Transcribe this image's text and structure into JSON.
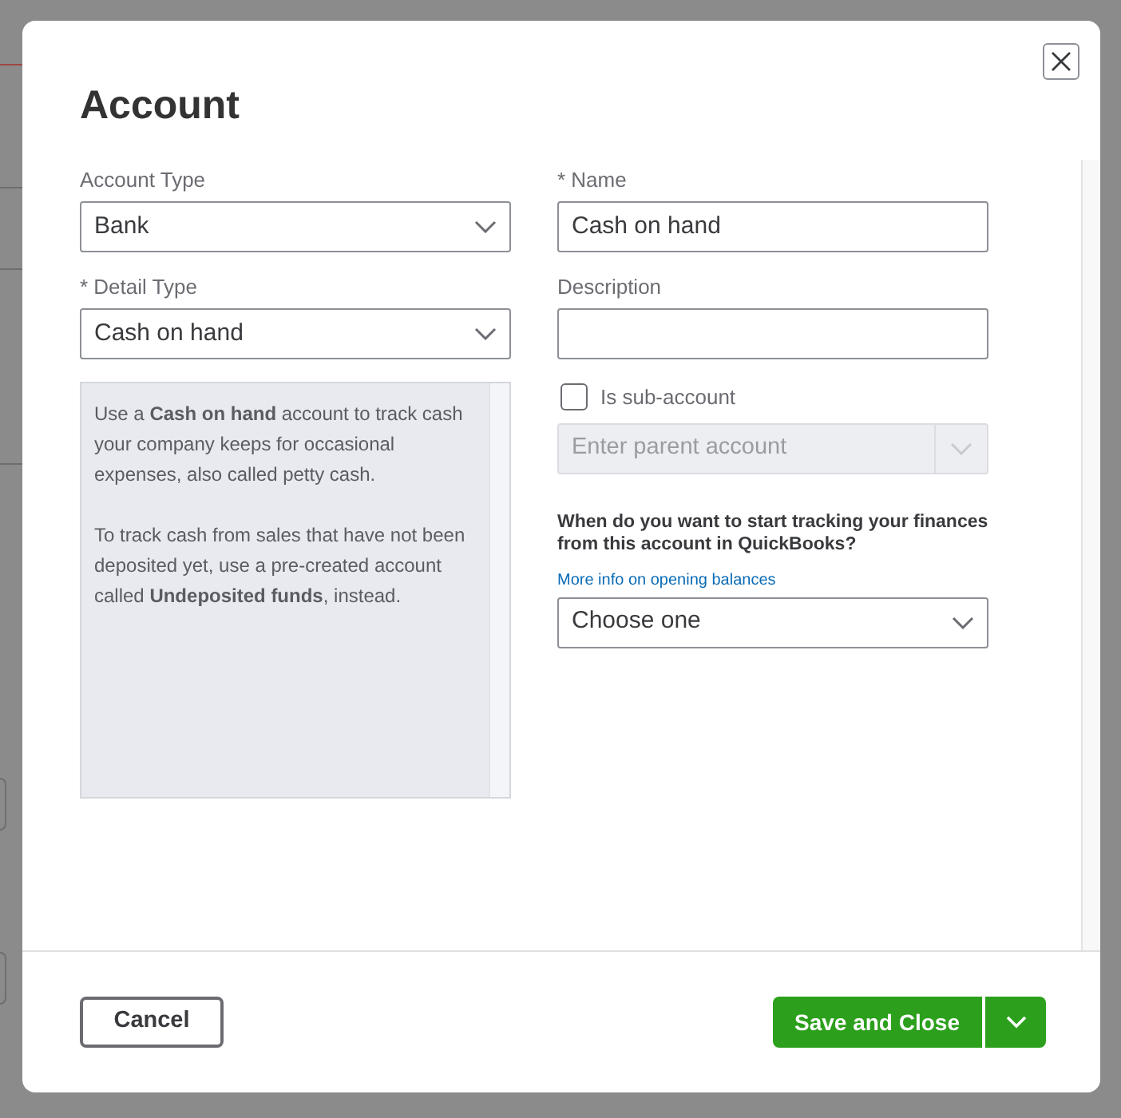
{
  "dialog": {
    "title": "Account",
    "account_type": {
      "label": "Account Type",
      "value": "Bank"
    },
    "name": {
      "label": "* Name",
      "value": "Cash on hand"
    },
    "detail_type": {
      "label": "* Detail Type",
      "value": "Cash on hand"
    },
    "description": {
      "label": "Description"
    },
    "detail_help": [
      "Use a **Cash on hand** account to track cash your company keeps for occasional expenses, also called petty cash.",
      "To track cash from sales that have not been deposited yet, use a pre-created account called **Undeposited funds**, instead."
    ],
    "sub_account": {
      "label": "Is sub-account",
      "checked": false
    },
    "parent_account": {
      "placeholder": "Enter parent account",
      "disabled": true
    },
    "opening_balance": {
      "question": "When do you want to start tracking your finances from this account in QuickBooks?",
      "link": "More info on opening balances",
      "value": "Choose one"
    },
    "buttons": {
      "cancel": "Cancel",
      "save": "Save and Close"
    }
  }
}
